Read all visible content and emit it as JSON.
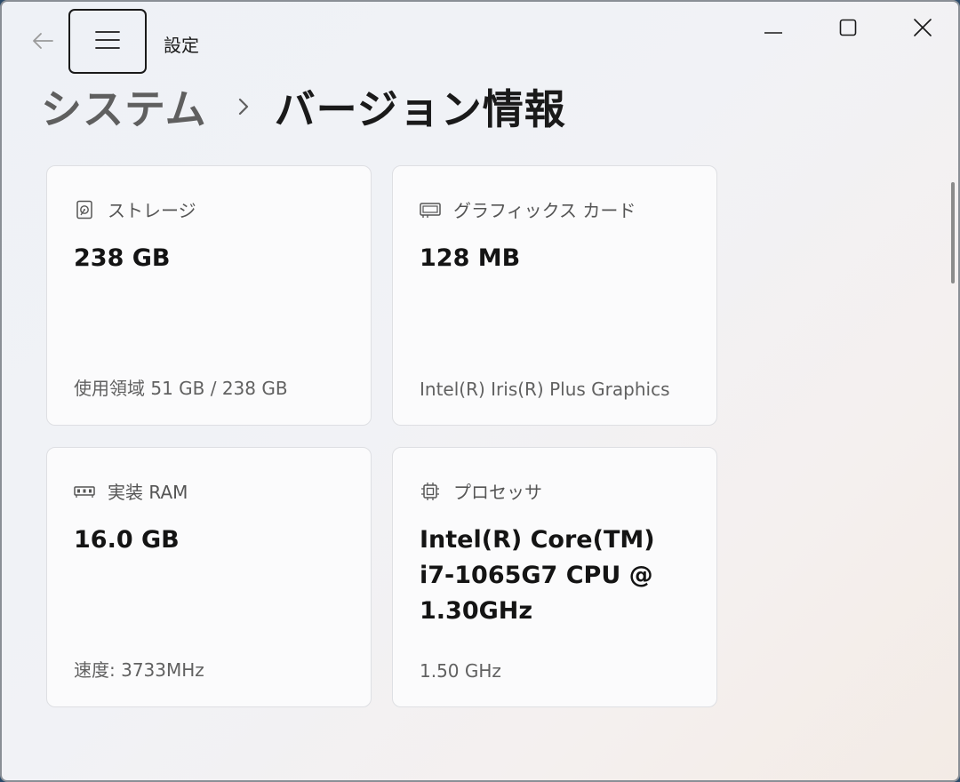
{
  "window": {
    "app_title": "設定",
    "controls": {
      "minimize": "minimize-icon",
      "maximize": "maximize-icon",
      "close": "close-icon"
    }
  },
  "breadcrumb": {
    "parent": "システム",
    "current": "バージョン情報"
  },
  "cards": [
    {
      "icon": "hard-drive-icon",
      "label": "ストレージ",
      "value": "238 GB",
      "sub": "使用領域 51 GB / 238 GB"
    },
    {
      "icon": "graphics-card-icon",
      "label": "グラフィックス カード",
      "value": "128 MB",
      "sub": "Intel(R) Iris(R) Plus Graphics"
    },
    {
      "icon": "memory-icon",
      "label": "実装 RAM",
      "value": "16.0 GB",
      "sub": "速度: 3733MHz"
    },
    {
      "icon": "processor-icon",
      "label": "プロセッサ",
      "value": "Intel(R) Core(TM) i7-1065G7 CPU @ 1.30GHz",
      "sub": "1.50 GHz"
    }
  ],
  "colors": {
    "accent_text": "#1a1a1a",
    "card_bg": "#fbfbfc",
    "muted_text": "#616161"
  }
}
